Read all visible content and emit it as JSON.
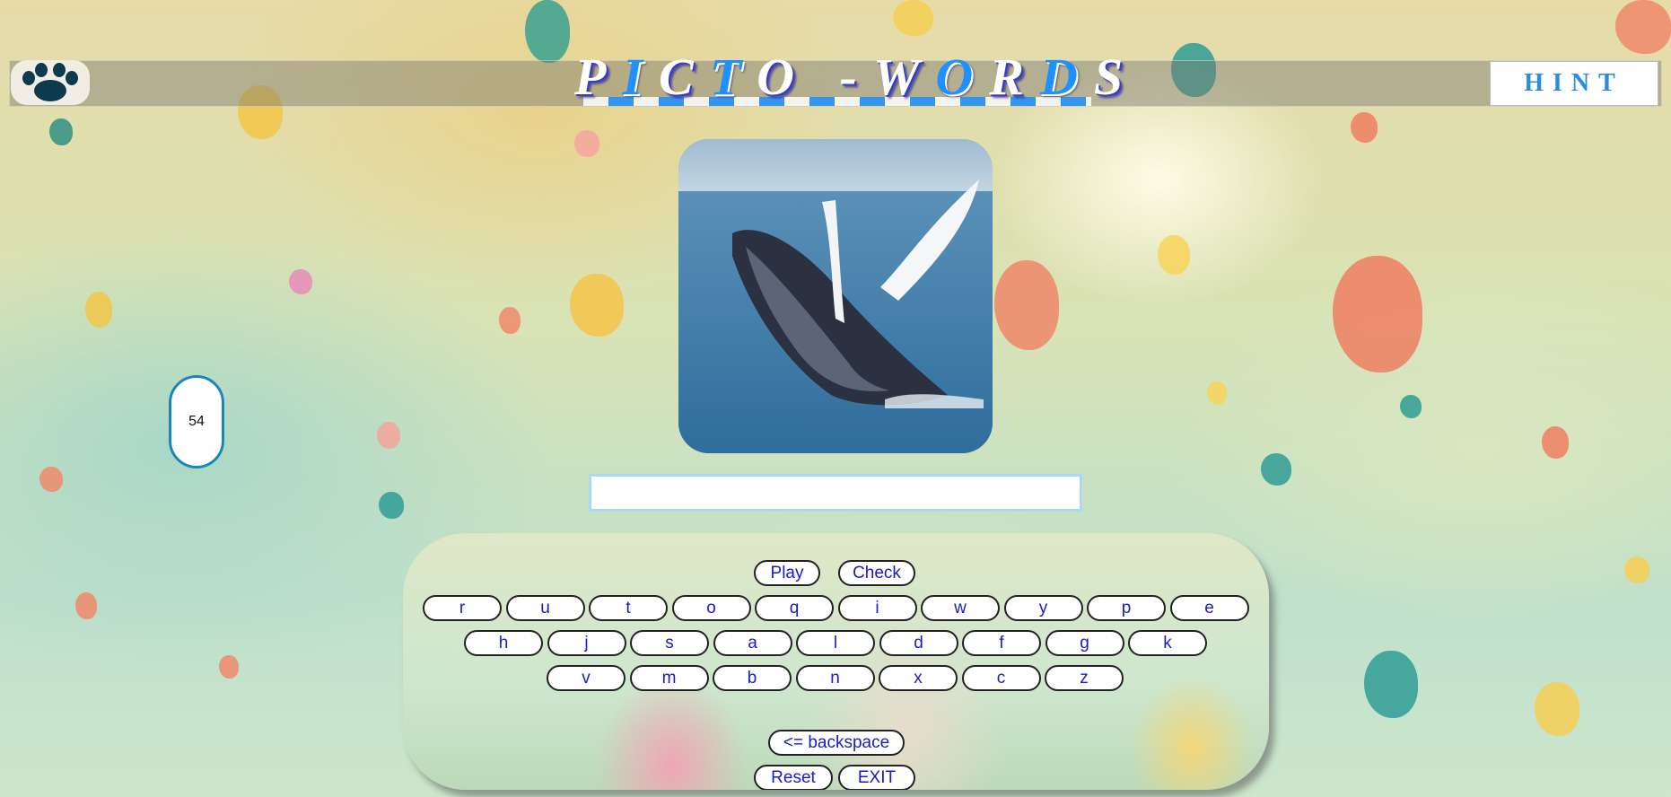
{
  "header": {
    "title_letters": [
      "P",
      "I",
      "C",
      "T",
      "O",
      " ",
      "-",
      "W",
      "O",
      "R",
      "D",
      "S"
    ],
    "title_highlight": [
      false,
      true,
      false,
      true,
      false,
      false,
      false,
      false,
      true,
      false,
      true,
      false
    ],
    "hint_label": "HINT",
    "paw_icon": "paw-icon"
  },
  "counter": {
    "value": "54"
  },
  "answer": {
    "value": "",
    "placeholder": ""
  },
  "picture": {
    "subject_icon": "whale-image"
  },
  "keyboard": {
    "play_label": "Play",
    "check_label": "Check",
    "row1": [
      "r",
      "u",
      "t",
      "o",
      "q",
      "i",
      "w",
      "y",
      "p",
      "e"
    ],
    "row2": [
      "h",
      "j",
      "s",
      "a",
      "l",
      "d",
      "f",
      "g",
      "k"
    ],
    "row3": [
      "v",
      "m",
      "b",
      "n",
      "x",
      "c",
      "z"
    ],
    "backspace_label": "<= backspace",
    "reset_label": "Reset",
    "exit_label": "EXIT"
  },
  "colors": {
    "accent": "#1e90ff",
    "key_text": "#1a1acc",
    "counter_border": "#1b86b8",
    "hint_text": "#2a8be0"
  }
}
